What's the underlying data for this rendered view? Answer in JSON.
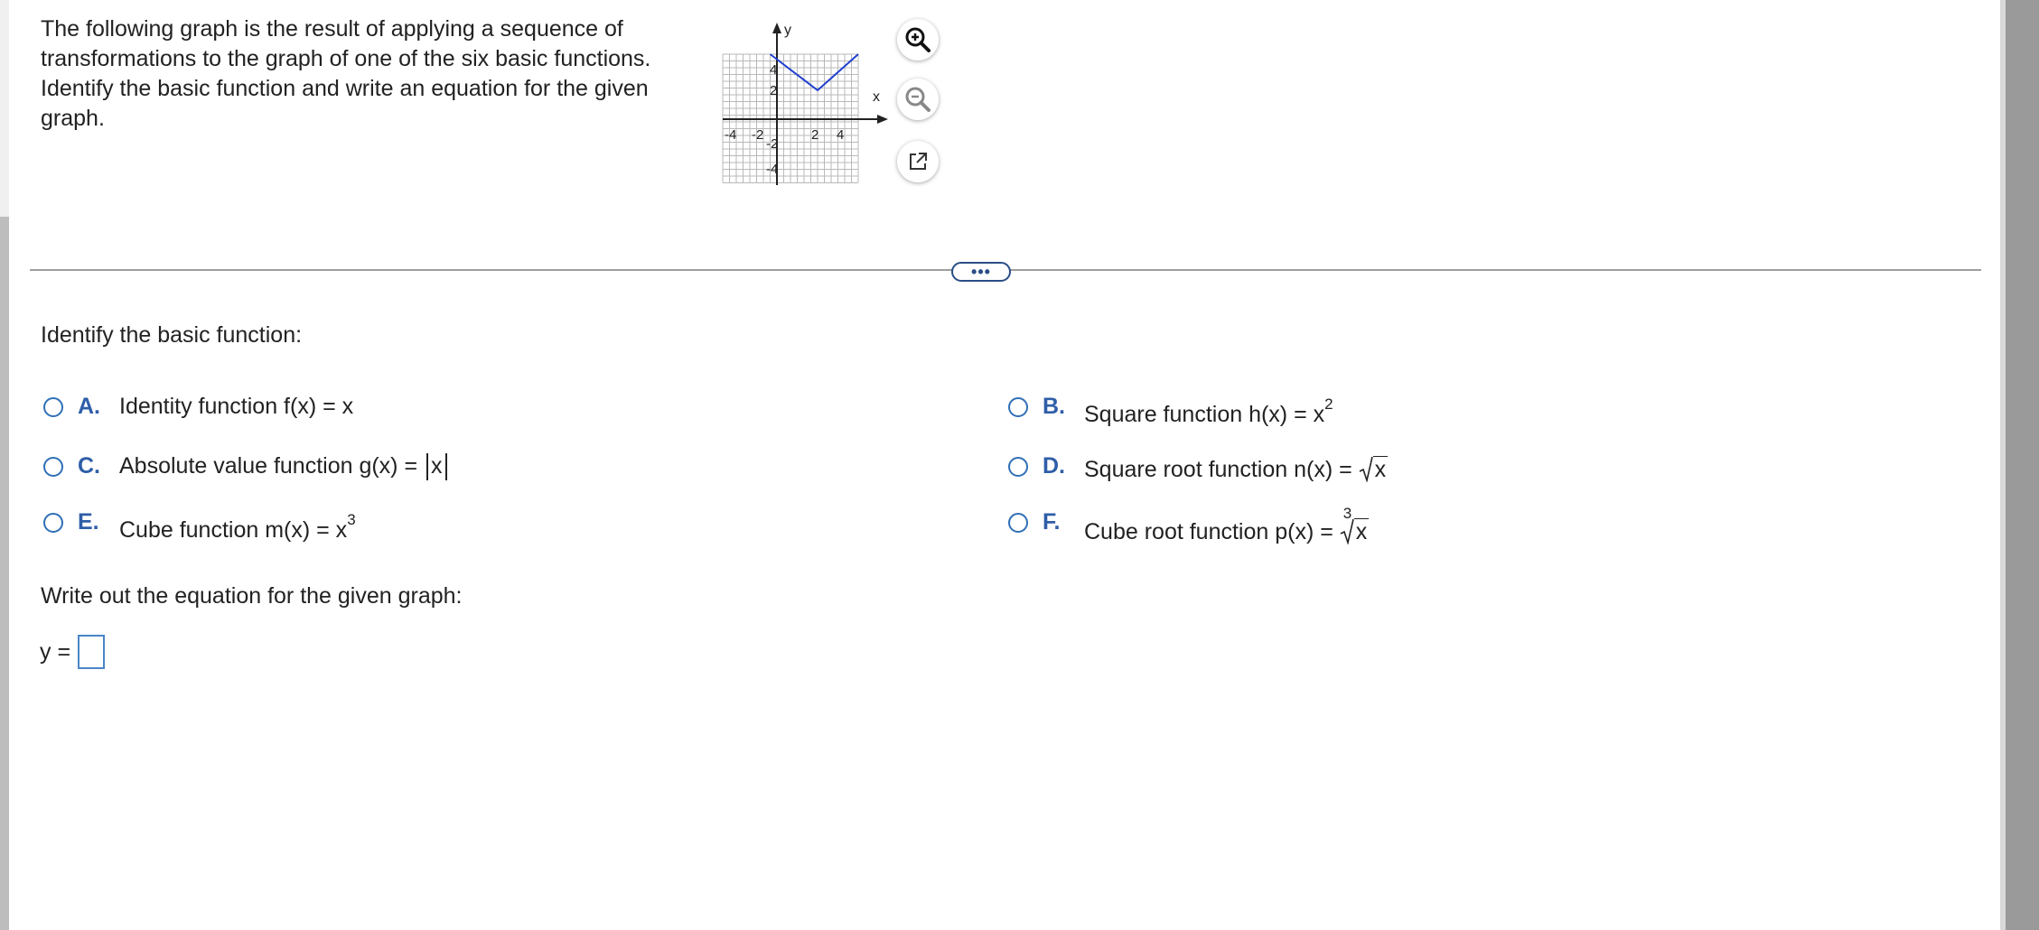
{
  "question": {
    "text": "The following graph is the result of applying a sequence of transformations to the graph of one of the six basic functions. Identify the basic function and write an equation for the given graph."
  },
  "graph": {
    "x_axis_label": "x",
    "y_axis_label": "y",
    "x_tick_labels": [
      "-4",
      "-2",
      "2",
      "4"
    ],
    "y_tick_labels": [
      "4",
      "2",
      "-2",
      "-4"
    ],
    "line_color": "#1f3fd0"
  },
  "tools": {
    "zoom_in_icon": "zoom-in-icon",
    "zoom_out_icon": "zoom-out-icon",
    "popout_icon": "external-link-icon"
  },
  "divider": {
    "more_label": "•••"
  },
  "part1": {
    "prompt": "Identify the basic function:",
    "options": [
      {
        "letter": "A.",
        "text": "Identity function f(x) = x"
      },
      {
        "letter": "B.",
        "text": "Square function h(x) = x",
        "exp": "2"
      },
      {
        "letter": "C.",
        "text": "Absolute value function g(x) = ",
        "abs": "x"
      },
      {
        "letter": "D.",
        "text": "Square root function n(x) = ",
        "rad": "x"
      },
      {
        "letter": "E.",
        "text": "Cube function m(x) = x",
        "exp": "3"
      },
      {
        "letter": "F.",
        "text": "Cube root function p(x) = ",
        "index": "3",
        "rad": "x"
      }
    ]
  },
  "part2": {
    "prompt": "Write out the equation for the given graph:",
    "answer_label": "y =",
    "answer_value": ""
  },
  "colors": {
    "accent": "#2f5ea8",
    "radio_border": "#2f6fb7",
    "input_border": "#4a86c8"
  }
}
